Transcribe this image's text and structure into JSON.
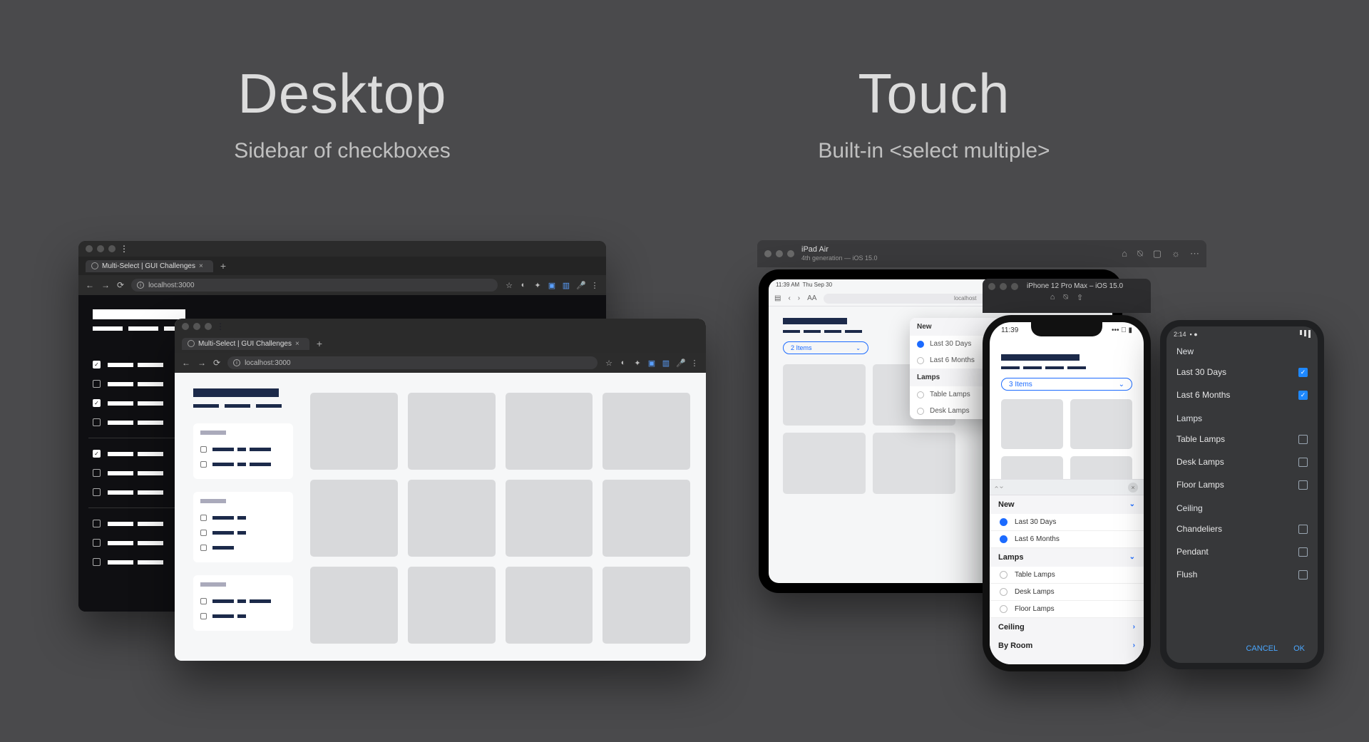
{
  "headings": {
    "desktop": {
      "title": "Desktop",
      "subtitle": "Sidebar of checkboxes"
    },
    "touch": {
      "title": "Touch",
      "subtitle": "Built-in <select multiple>"
    }
  },
  "browser": {
    "tab_title": "Multi-Select | GUI Challenges",
    "address": "localhost:3000"
  },
  "simulator": {
    "ipad_name": "iPad Air",
    "ipad_sub": "4th generation — iOS 15.0",
    "iphone_name": "iPhone 12 Pro Max – iOS 15.0"
  },
  "ipad": {
    "status_time": "11:39 AM",
    "status_date": "Thu Sep 30",
    "addr_hint": "AA",
    "addr": "localhost",
    "pill": "2 Items",
    "popover": {
      "groups": [
        {
          "title": "New",
          "options": [
            {
              "label": "Last 30 Days",
              "selected": true
            },
            {
              "label": "Last 6 Months",
              "selected": false
            }
          ]
        },
        {
          "title": "Lamps",
          "options": [
            {
              "label": "Table Lamps",
              "selected": false
            },
            {
              "label": "Desk Lamps",
              "selected": false
            }
          ]
        }
      ]
    }
  },
  "iphone": {
    "status_time": "11:39",
    "pill": "3 Items",
    "sheet": {
      "groups": [
        {
          "title": "New",
          "expanded": true,
          "options": [
            {
              "label": "Last 30 Days",
              "selected": true
            },
            {
              "label": "Last 6 Months",
              "selected": true
            }
          ]
        },
        {
          "title": "Lamps",
          "expanded": true,
          "options": [
            {
              "label": "Table Lamps",
              "selected": false
            },
            {
              "label": "Desk Lamps",
              "selected": false
            },
            {
              "label": "Floor Lamps",
              "selected": false
            }
          ]
        },
        {
          "title": "Ceiling",
          "expanded": false,
          "options": []
        },
        {
          "title": "By Room",
          "expanded": false,
          "options": []
        }
      ]
    }
  },
  "android": {
    "status_time": "2:14",
    "groups": [
      {
        "title": "New",
        "options": [
          {
            "label": "Last 30 Days",
            "selected": true
          },
          {
            "label": "Last 6 Months",
            "selected": true
          }
        ]
      },
      {
        "title": "Lamps",
        "options": [
          {
            "label": "Table Lamps",
            "selected": false
          },
          {
            "label": "Desk Lamps",
            "selected": false
          },
          {
            "label": "Floor Lamps",
            "selected": false
          }
        ]
      },
      {
        "title": "Ceiling",
        "options": [
          {
            "label": "Chandeliers",
            "selected": false
          },
          {
            "label": "Pendant",
            "selected": false
          },
          {
            "label": "Flush",
            "selected": false
          }
        ]
      }
    ],
    "buttons": {
      "cancel": "CANCEL",
      "ok": "OK"
    }
  }
}
